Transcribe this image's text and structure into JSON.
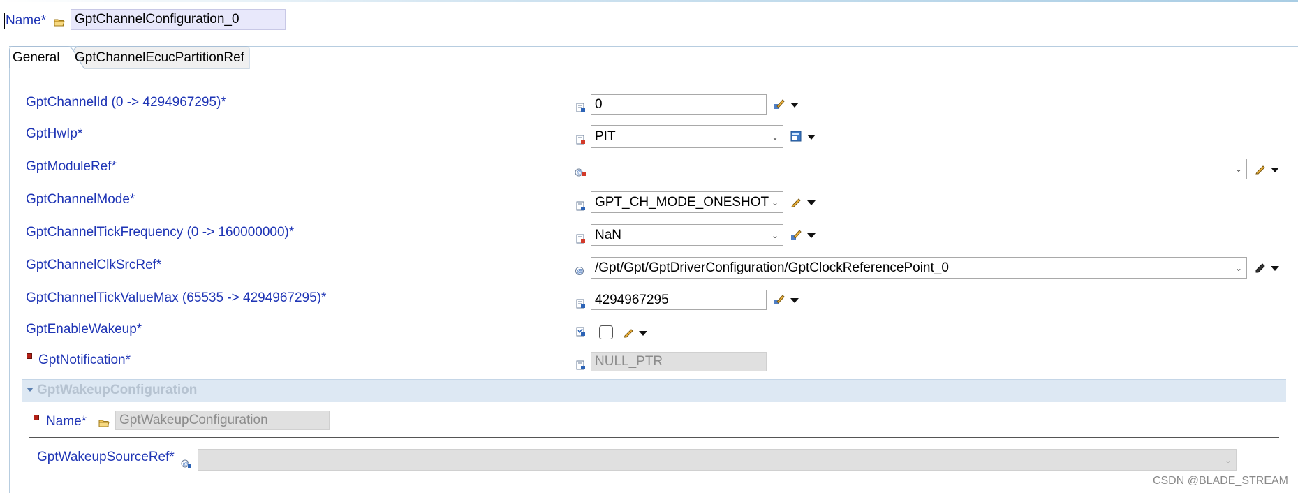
{
  "header": {
    "name_label": "Name*",
    "name_value": "GptChannelConfiguration_0"
  },
  "tabs": [
    {
      "label": "General",
      "active": true
    },
    {
      "label": "GptChannelEcucPartitionRef",
      "active": false
    }
  ],
  "general": {
    "channel_id": {
      "label": "GptChannelId (0 -> 4294967295)*",
      "value": "0"
    },
    "hwip": {
      "label": "GptHwIp*",
      "value": "PIT"
    },
    "module_ref": {
      "label": "GptModuleRef*",
      "value": ""
    },
    "channel_mode": {
      "label": "GptChannelMode*",
      "value": "GPT_CH_MODE_ONESHOT"
    },
    "tick_frequency": {
      "label": "GptChannelTickFrequency (0 -> 160000000)*",
      "value": "NaN"
    },
    "clk_src_ref": {
      "label": "GptChannelClkSrcRef*",
      "value": "/Gpt/Gpt/GptDriverConfiguration/GptClockReferencePoint_0"
    },
    "tick_value_max": {
      "label": "GptChannelTickValueMax (65535 -> 4294967295)*",
      "value": "4294967295"
    },
    "enable_wakeup": {
      "label": "GptEnableWakeup*",
      "checked": false
    },
    "notification": {
      "label": "GptNotification*",
      "value": "NULL_PTR"
    }
  },
  "wakeup_section": {
    "title": "GptWakeupConfiguration",
    "name_label": "Name*",
    "name_value": "GptWakeupConfiguration",
    "source_ref_label": "GptWakeupSourceRef*",
    "source_ref_value": ""
  },
  "watermark": "CSDN @BLADE_STREAM",
  "colors": {
    "label_blue": "#1f35b5",
    "section_bg": "#dde8f3",
    "required_marker": "#b42016",
    "disabled_field": "#e0e0e0"
  },
  "icons": {
    "name": "folder-icon",
    "numeric_param": "numeric-parameter-icon",
    "enum_param": "enum-parameter-icon",
    "reference_param": "reference-parameter-icon",
    "boolean_param": "boolean-parameter-icon",
    "pencil": "pencil-icon",
    "calculator": "calculator-icon"
  }
}
